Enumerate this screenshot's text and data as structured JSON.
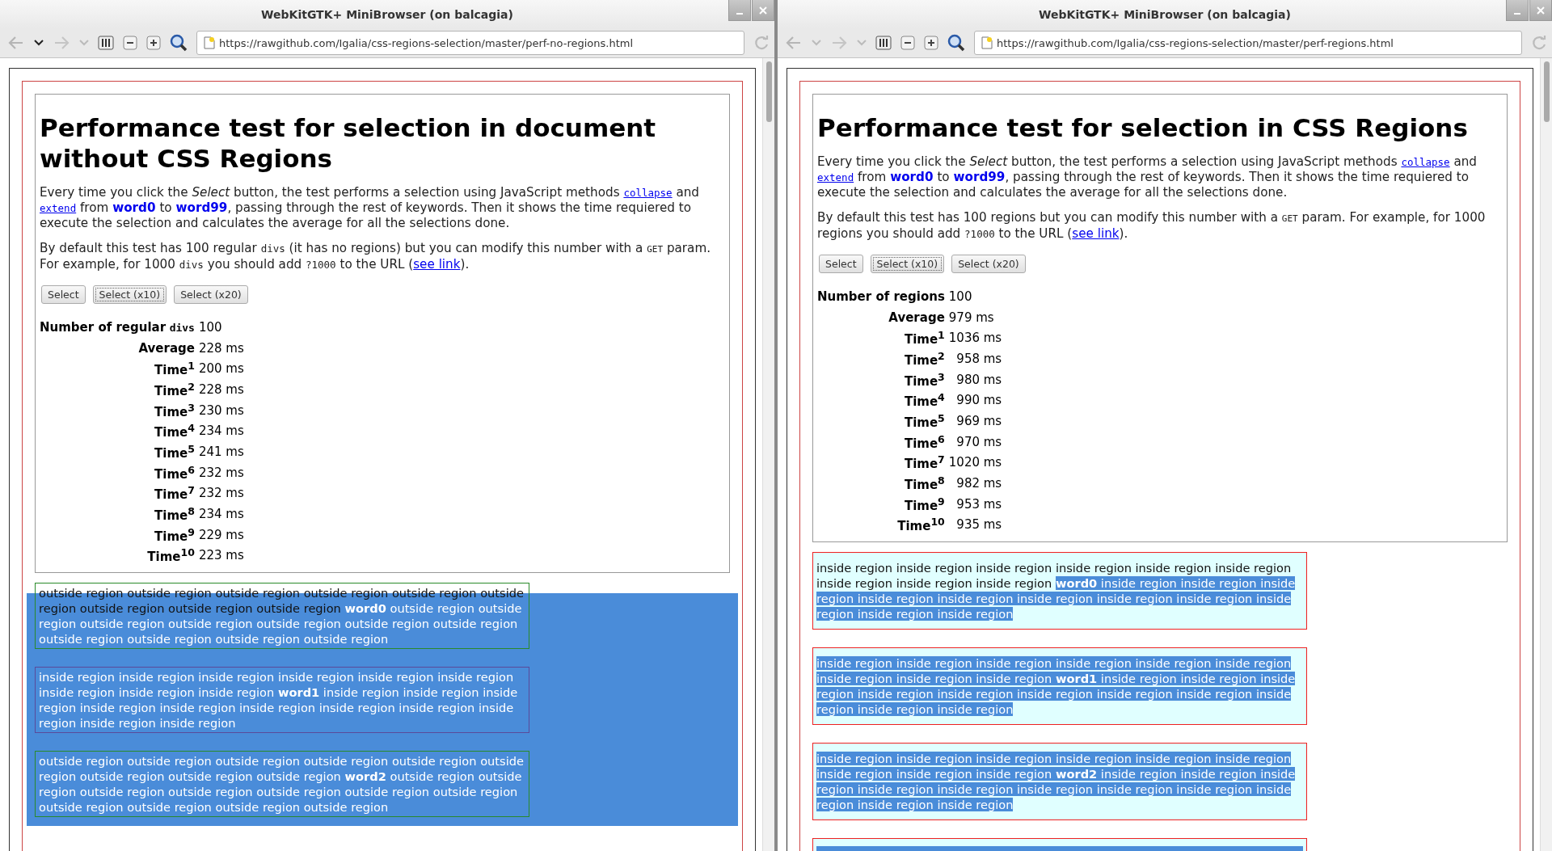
{
  "windows": [
    {
      "title": "WebKitGTK+ MiniBrowser (on balcagia)",
      "url": "https://rawgithub.com/Igalia/css-regions-selection/master/perf-no-regions.html",
      "back_menu_enabled": true,
      "kind": "plain",
      "heading": "Performance test for selection in document without CSS Regions",
      "intro": [
        {
          "text": "Every time you click the ",
          "kind": "text"
        },
        {
          "text": "Select",
          "kind": "em"
        },
        {
          "text": " button, the test performs a selection using JavaScript methods ",
          "kind": "text"
        },
        {
          "text": "collapse",
          "kind": "codelink"
        },
        {
          "text": " and ",
          "kind": "text"
        },
        {
          "text": "extend",
          "kind": "codelink"
        },
        {
          "text": " from ",
          "kind": "text"
        },
        {
          "text": "word0",
          "kind": "word"
        },
        {
          "text": " to ",
          "kind": "text"
        },
        {
          "text": "word99",
          "kind": "word"
        },
        {
          "text": ", passing through the rest of keywords. Then it shows the time requiered to execute the selection and calculates the average for all the selections done.",
          "kind": "text"
        }
      ],
      "defaults": [
        {
          "text": "By default this test has 100 regular ",
          "kind": "text"
        },
        {
          "text": "divs",
          "kind": "code"
        },
        {
          "text": " (it has no regions) but you can modify this number with a ",
          "kind": "text"
        },
        {
          "text": "GET",
          "kind": "caps"
        },
        {
          "text": " param. For example, for 1000 ",
          "kind": "text"
        },
        {
          "text": "divs",
          "kind": "code"
        },
        {
          "text": " you should add ",
          "kind": "text"
        },
        {
          "text": "?1000",
          "kind": "code"
        },
        {
          "text": " to the URL (",
          "kind": "text"
        },
        {
          "text": "see link",
          "kind": "link"
        },
        {
          "text": ").",
          "kind": "text"
        }
      ],
      "buttons": [
        {
          "label": "Select",
          "focused": false
        },
        {
          "label": "Select (x10)",
          "focused": true
        },
        {
          "label": "Select (x20)",
          "focused": false
        }
      ],
      "stats": [
        {
          "kind": "count",
          "label": "Number of regular",
          "code": "divs",
          "value": "100"
        },
        {
          "kind": "average",
          "label": "Average",
          "value": "228 ms"
        },
        {
          "kind": "time",
          "label": "Time$^{1}$",
          "value": "200 ms"
        },
        {
          "kind": "time",
          "label": "Time$^{2}$",
          "value": "228 ms"
        },
        {
          "kind": "time",
          "label": "Time$^{3}$",
          "value": "230 ms"
        },
        {
          "kind": "time",
          "label": "Time$^{4}$",
          "value": "234 ms"
        },
        {
          "kind": "time",
          "label": "Time$^{5}$",
          "value": "241 ms"
        },
        {
          "kind": "time",
          "label": "Time$^{6}$",
          "value": "232 ms"
        },
        {
          "kind": "time",
          "label": "Time$^{7}$",
          "value": "232 ms"
        },
        {
          "kind": "time",
          "label": "Time$^{8}$",
          "value": "234 ms"
        },
        {
          "kind": "time",
          "label": "Time$^{9}$",
          "value": "229 ms"
        },
        {
          "kind": "time",
          "label": "Time$^{10}$",
          "value": "223 ms"
        }
      ],
      "regions": [
        {
          "kind": "outside",
          "segments": [
            {
              "text": "outside region outside region outside region outside region outside region outside region outside region outside region outside region ",
              "selected": false,
              "bold": false
            },
            {
              "text": "word0",
              "selected": true,
              "bold": true
            },
            {
              "text": " outside region outside region outside region outside region outside region outside region outside region outside region outside region outside region outside region",
              "selected": true,
              "bold": false
            }
          ]
        },
        {
          "kind": "inside",
          "segments": [
            {
              "text": "inside region inside region inside region inside region inside region inside region inside region inside region inside region ",
              "selected": true,
              "bold": false
            },
            {
              "text": "word1",
              "selected": true,
              "bold": true
            },
            {
              "text": " inside region inside region inside region inside region inside region inside region inside region inside region inside region inside region inside region",
              "selected": true,
              "bold": false
            }
          ]
        },
        {
          "kind": "outside",
          "segments": [
            {
              "text": "outside region outside region outside region outside region outside region outside region outside region outside region outside region ",
              "selected": true,
              "bold": false
            },
            {
              "text": "word2",
              "selected": true,
              "bold": true
            },
            {
              "text": " outside region outside region outside region outside region outside region outside region outside region outside region outside region outside region outside region",
              "selected": true,
              "bold": false
            }
          ]
        }
      ]
    },
    {
      "title": "WebKitGTK+ MiniBrowser (on balcagia)",
      "url": "https://rawgithub.com/Igalia/css-regions-selection/master/perf-regions.html",
      "back_menu_enabled": false,
      "kind": "regions",
      "heading": "Performance test for selection in CSS Regions",
      "intro": [
        {
          "text": "Every time you click the ",
          "kind": "text"
        },
        {
          "text": "Select",
          "kind": "em"
        },
        {
          "text": " button, the test performs a selection using JavaScript methods ",
          "kind": "text"
        },
        {
          "text": "collapse",
          "kind": "codelink"
        },
        {
          "text": " and ",
          "kind": "text"
        },
        {
          "text": "extend",
          "kind": "codelink"
        },
        {
          "text": " from ",
          "kind": "text"
        },
        {
          "text": "word0",
          "kind": "word"
        },
        {
          "text": " to ",
          "kind": "text"
        },
        {
          "text": "word99",
          "kind": "word"
        },
        {
          "text": ", passing through the rest of keywords. Then it shows the time requiered to execute the selection and calculates the average for all the selections done.",
          "kind": "text"
        }
      ],
      "defaults": [
        {
          "text": "By default this test has 100 regions but you can modify this number with a ",
          "kind": "text"
        },
        {
          "text": "GET",
          "kind": "caps"
        },
        {
          "text": " param. For example, for 1000 regions you should add ",
          "kind": "text"
        },
        {
          "text": "?1000",
          "kind": "code"
        },
        {
          "text": " to the URL (",
          "kind": "text"
        },
        {
          "text": "see link",
          "kind": "link"
        },
        {
          "text": ").",
          "kind": "text"
        }
      ],
      "buttons": [
        {
          "label": "Select",
          "focused": false
        },
        {
          "label": "Select (x10)",
          "focused": true
        },
        {
          "label": "Select (x20)",
          "focused": false
        }
      ],
      "stats": [
        {
          "kind": "count",
          "label": "Number of regions",
          "value": "100"
        },
        {
          "kind": "average",
          "label": "Average",
          "value": "979 ms"
        },
        {
          "kind": "time",
          "label": "Time$^{1}$",
          "value": "1036 ms"
        },
        {
          "kind": "time",
          "label": "Time$^{2}$",
          "value": "958 ms"
        },
        {
          "kind": "time",
          "label": "Time$^{3}$",
          "value": "980 ms"
        },
        {
          "kind": "time",
          "label": "Time$^{4}$",
          "value": "990 ms"
        },
        {
          "kind": "time",
          "label": "Time$^{5}$",
          "value": "969 ms"
        },
        {
          "kind": "time",
          "label": "Time$^{6}$",
          "value": "970 ms"
        },
        {
          "kind": "time",
          "label": "Time$^{7}$",
          "value": "1020 ms"
        },
        {
          "kind": "time",
          "label": "Time$^{8}$",
          "value": "982 ms"
        },
        {
          "kind": "time",
          "label": "Time$^{9}$",
          "value": "953 ms"
        },
        {
          "kind": "time",
          "label": "Time$^{10}$",
          "value": "935 ms"
        }
      ],
      "regions": [
        {
          "kind": "region",
          "segments": [
            {
              "text": "inside region inside region inside region inside region inside region inside region inside region inside region inside region ",
              "selected": false,
              "bold": false
            },
            {
              "text": "word0",
              "selected": true,
              "bold": true
            },
            {
              "text": " inside region inside region inside region inside region inside region inside region inside region inside region inside region inside region inside region",
              "selected": true,
              "bold": false
            }
          ]
        },
        {
          "kind": "region",
          "segments": [
            {
              "text": "inside region inside region inside region inside region inside region inside region inside region inside region inside region ",
              "selected": true,
              "bold": false
            },
            {
              "text": "word1",
              "selected": true,
              "bold": true
            },
            {
              "text": " inside region inside region inside region inside region inside region inside region inside region inside region inside region inside region inside region",
              "selected": true,
              "bold": false
            }
          ]
        },
        {
          "kind": "region",
          "segments": [
            {
              "text": "inside region inside region inside region inside region inside region inside region inside region inside region inside region ",
              "selected": true,
              "bold": false
            },
            {
              "text": "word2",
              "selected": true,
              "bold": true
            },
            {
              "text": " inside region inside region inside region inside region inside region inside region inside region inside region inside region inside region inside region",
              "selected": true,
              "bold": false
            }
          ]
        },
        {
          "kind": "region-edge"
        }
      ]
    }
  ]
}
